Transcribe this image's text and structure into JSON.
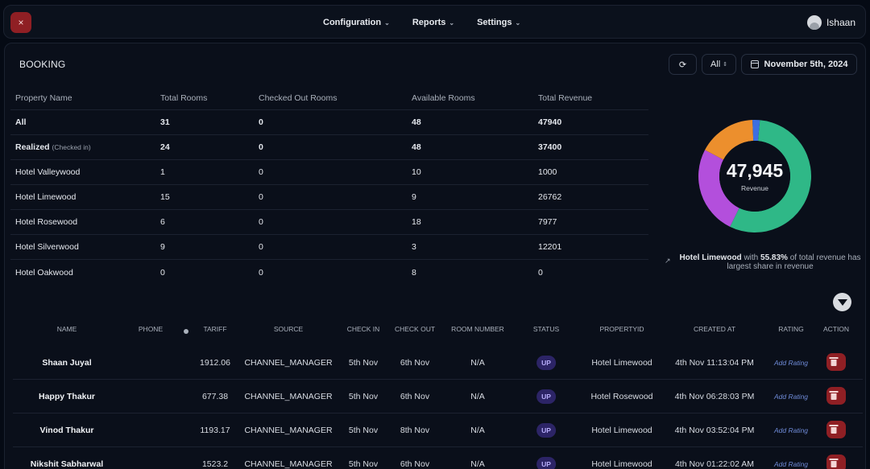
{
  "header": {
    "close_icon": "×",
    "menu": [
      {
        "label": "Configuration"
      },
      {
        "label": "Reports"
      },
      {
        "label": "Settings"
      }
    ],
    "user": {
      "name": "Ishaan"
    }
  },
  "page": {
    "title": "BOOKING",
    "refresh_icon": "⟳",
    "filter_select": "All",
    "date": "November 5th, 2024"
  },
  "summary": {
    "columns": [
      "Property Name",
      "Total Rooms",
      "Checked Out Rooms",
      "Available Rooms",
      "Total Revenue"
    ],
    "rows": [
      {
        "name": "All",
        "note": "",
        "total_rooms": "31",
        "checked_out": "0",
        "available": "48",
        "revenue": "47940"
      },
      {
        "name": "Realized",
        "note": "(Checked in)",
        "total_rooms": "24",
        "checked_out": "0",
        "available": "48",
        "revenue": "37400"
      },
      {
        "name": "Hotel Valleywood",
        "note": "",
        "total_rooms": "1",
        "checked_out": "0",
        "available": "10",
        "revenue": "1000"
      },
      {
        "name": "Hotel Limewood",
        "note": "",
        "total_rooms": "15",
        "checked_out": "0",
        "available": "9",
        "revenue": "26762"
      },
      {
        "name": "Hotel Rosewood",
        "note": "",
        "total_rooms": "6",
        "checked_out": "0",
        "available": "18",
        "revenue": "7977"
      },
      {
        "name": "Hotel Silverwood",
        "note": "",
        "total_rooms": "9",
        "checked_out": "0",
        "available": "3",
        "revenue": "12201"
      },
      {
        "name": "Hotel Oakwood",
        "note": "",
        "total_rooms": "0",
        "checked_out": "0",
        "available": "8",
        "revenue": "0"
      }
    ]
  },
  "donut": {
    "value": "47,945",
    "label": "Revenue",
    "segments": [
      {
        "name": "Hotel Limewood",
        "share": 0.5583,
        "color": "#2fb887"
      },
      {
        "name": "Hotel Silverwood",
        "share": 0.2545,
        "color": "#b34fdc"
      },
      {
        "name": "Hotel Rosewood",
        "share": 0.1664,
        "color": "#ec8f2d"
      },
      {
        "name": "Hotel Valleywood",
        "share": 0.0209,
        "color": "#3d6fe0"
      }
    ],
    "insight": {
      "hotel": "Hotel Limewood",
      "with_text": " with ",
      "percent": "55.83%",
      "rest": " of total revenue has largest share in revenue"
    }
  },
  "bookings": {
    "columns": [
      "NAME",
      "PHONE",
      "TARIFF",
      "SOURCE",
      "CHECK IN",
      "CHECK OUT",
      "ROOM NUMBER",
      "STATUS",
      "PROPERTYID",
      "CREATED AT",
      "RATING",
      "ACTION"
    ],
    "rows": [
      {
        "name": "Shaan Juyal",
        "phone": "",
        "tariff": "1912.06",
        "source": "CHANNEL_MANAGER",
        "check_in": "5th Nov",
        "check_out": "6th Nov",
        "room": "N/A",
        "status": "UP",
        "property": "Hotel Limewood",
        "created": "4th Nov 11:13:04 PM",
        "rating": "Add Rating"
      },
      {
        "name": "Happy Thakur",
        "phone": "",
        "tariff": "677.38",
        "source": "CHANNEL_MANAGER",
        "check_in": "5th Nov",
        "check_out": "6th Nov",
        "room": "N/A",
        "status": "UP",
        "property": "Hotel Rosewood",
        "created": "4th Nov 06:28:03 PM",
        "rating": "Add Rating"
      },
      {
        "name": "Vinod Thakur",
        "phone": "",
        "tariff": "1193.17",
        "source": "CHANNEL_MANAGER",
        "check_in": "5th Nov",
        "check_out": "8th Nov",
        "room": "N/A",
        "status": "UP",
        "property": "Hotel Limewood",
        "created": "4th Nov 03:52:04 PM",
        "rating": "Add Rating"
      },
      {
        "name": "Nikshit Sabharwal",
        "phone": "",
        "tariff": "1523.2",
        "source": "CHANNEL_MANAGER",
        "check_in": "5th Nov",
        "check_out": "6th Nov",
        "room": "N/A",
        "status": "UP",
        "property": "Hotel Limewood",
        "created": "4th Nov 01:22:02 AM",
        "rating": "Add Rating"
      }
    ]
  }
}
